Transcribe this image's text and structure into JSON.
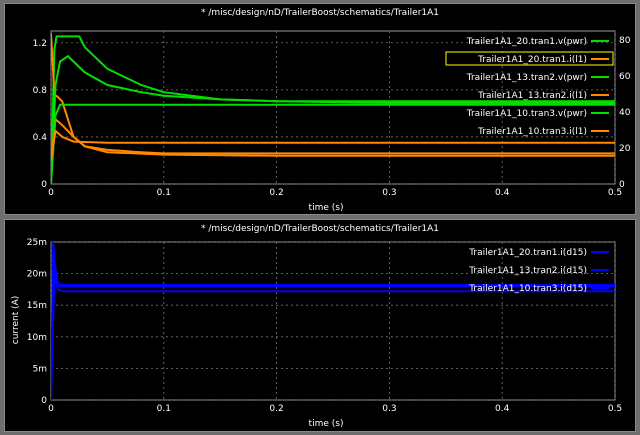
{
  "chart_data": [
    {
      "type": "line",
      "title": "* /misc/design/nD/TrailerBoost/schematics/Trailer1A1",
      "xlabel": "time (s)",
      "ylabel_left": "",
      "ylabel_right": "",
      "xlim": [
        0,
        0.5
      ],
      "ylim_left": [
        0,
        1.3
      ],
      "ylim_right": [
        0,
        85
      ],
      "x_ticks": [
        0,
        0.1,
        0.2,
        0.3,
        0.4,
        0.5
      ],
      "x_tick_labels": [
        "0",
        "0.1",
        "0.2",
        "0.3",
        "0.4",
        "0.5"
      ],
      "y_ticks_left": [
        0,
        0.4,
        0.8,
        1.2
      ],
      "y_tick_labels_left": [
        "0",
        "0.4",
        "0.8",
        "1.2"
      ],
      "y_ticks_right": [
        0,
        20,
        40,
        60,
        80
      ],
      "y_tick_labels_right": [
        "0",
        "20",
        "40",
        "60",
        "80"
      ],
      "grid": true,
      "legend_position": "top-right",
      "highlighted_legend_index": 1,
      "series": [
        {
          "name": "Trailer1A1_20.tran1.v(pwr)",
          "color": "#00e000",
          "axis": "right",
          "x": [
            0,
            0.003,
            0.005,
            0.01,
            0.015,
            0.025,
            0.03,
            0.05,
            0.08,
            0.1,
            0.15,
            0.2,
            0.3,
            0.4,
            0.5
          ],
          "y": [
            0,
            75,
            82,
            82,
            82,
            82,
            76,
            64,
            55,
            51,
            47,
            46,
            45,
            45,
            45
          ]
        },
        {
          "name": "Trailer1A1_20.tran1.i(l1)",
          "color": "#ff8800",
          "axis": "left",
          "x": [
            0,
            0.003,
            0.006,
            0.01,
            0.015,
            0.02,
            0.03,
            0.05,
            0.08,
            0.1,
            0.2,
            0.3,
            0.4,
            0.5
          ],
          "y": [
            1.28,
            0.76,
            0.74,
            0.7,
            0.55,
            0.4,
            0.32,
            0.29,
            0.27,
            0.26,
            0.26,
            0.26,
            0.26,
            0.26
          ]
        },
        {
          "name": "Trailer1A1_13.tran2.v(pwr)",
          "color": "#00e000",
          "axis": "right",
          "x": [
            0,
            0.004,
            0.008,
            0.015,
            0.02,
            0.03,
            0.05,
            0.08,
            0.1,
            0.15,
            0.2,
            0.3,
            0.4,
            0.5
          ],
          "y": [
            0,
            55,
            68,
            71,
            68,
            62,
            55,
            51,
            49,
            47,
            46,
            46,
            46,
            46
          ]
        },
        {
          "name": "Trailer1A1_13.tran2.i(l1)",
          "color": "#ff8800",
          "axis": "left",
          "x": [
            0,
            0.004,
            0.01,
            0.02,
            0.03,
            0.05,
            0.1,
            0.2,
            0.3,
            0.4,
            0.5
          ],
          "y": [
            0.2,
            0.55,
            0.5,
            0.4,
            0.32,
            0.27,
            0.25,
            0.24,
            0.24,
            0.24,
            0.24
          ]
        },
        {
          "name": "Trailer1A1_10.tran3.v(pwr)",
          "color": "#00e000",
          "axis": "right",
          "x": [
            0,
            0.004,
            0.008,
            0.015,
            0.02,
            0.05,
            0.1,
            0.2,
            0.3,
            0.4,
            0.5
          ],
          "y": [
            0,
            38,
            44,
            44,
            44,
            44,
            44,
            44,
            44,
            44,
            44
          ]
        },
        {
          "name": "Trailer1A1_10.tran3.i(l1)",
          "color": "#ff8800",
          "axis": "left",
          "x": [
            0,
            0.004,
            0.01,
            0.02,
            0.05,
            0.1,
            0.2,
            0.3,
            0.4,
            0.5
          ],
          "y": [
            0.2,
            0.45,
            0.4,
            0.36,
            0.35,
            0.35,
            0.35,
            0.35,
            0.35,
            0.35
          ]
        }
      ]
    },
    {
      "type": "line",
      "title": "* /misc/design/nD/TrailerBoost/schematics/Trailer1A1",
      "xlabel": "time (s)",
      "ylabel": "current (A)",
      "xlim": [
        0,
        0.5
      ],
      "ylim": [
        0,
        0.025
      ],
      "x_ticks": [
        0,
        0.1,
        0.2,
        0.3,
        0.4,
        0.5
      ],
      "x_tick_labels": [
        "0",
        "0.1",
        "0.2",
        "0.3",
        "0.4",
        "0.5"
      ],
      "y_ticks": [
        0,
        0.005,
        0.01,
        0.015,
        0.02,
        0.025
      ],
      "y_tick_labels": [
        "0",
        "5m",
        "10m",
        "15m",
        "20m",
        "25m"
      ],
      "grid": true,
      "legend_position": "top-right",
      "series": [
        {
          "name": "Trailer1A1_20.tran1.i(d15)",
          "color": "#0000ff",
          "x": [
            0,
            0.002,
            0.004,
            0.006,
            0.01,
            0.1,
            0.2,
            0.3,
            0.4,
            0.5
          ],
          "y": [
            0,
            0.025,
            0.019,
            0.018,
            0.018,
            0.018,
            0.018,
            0.018,
            0.018,
            0.018
          ]
        },
        {
          "name": "Trailer1A1_13.tran2.i(d15)",
          "color": "#0000ff",
          "x": [
            0,
            0.003,
            0.006,
            0.01,
            0.1,
            0.2,
            0.3,
            0.4,
            0.5
          ],
          "y": [
            0,
            0.022,
            0.0185,
            0.0182,
            0.0182,
            0.0182,
            0.0182,
            0.0182,
            0.0182
          ]
        },
        {
          "name": "Trailer1A1_10.tran3.i(d15)",
          "color": "#0000ff",
          "x": [
            0,
            0.003,
            0.006,
            0.01,
            0.1,
            0.2,
            0.3,
            0.4,
            0.5
          ],
          "y": [
            0,
            0.02,
            0.0175,
            0.0172,
            0.0172,
            0.0172,
            0.0172,
            0.0172,
            0.0172
          ]
        }
      ]
    }
  ]
}
